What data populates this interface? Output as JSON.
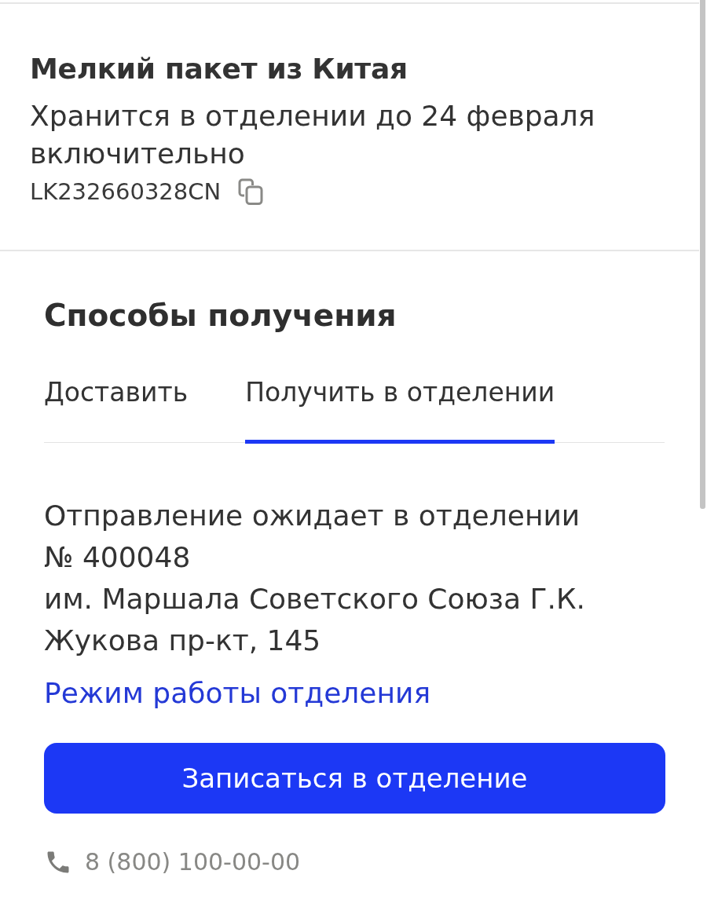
{
  "package": {
    "title": "Мелкий пакет из Китая",
    "storage_note": "Хранится в отделении до 24 февраля включительно",
    "tracking_number": "LK232660328CN"
  },
  "pickup": {
    "heading": "Способы получения",
    "tabs": [
      {
        "label": "Доставить",
        "selected": false
      },
      {
        "label": "Получить в отделении",
        "selected": true
      }
    ],
    "office": {
      "status": "Отправление ожидает в отделении № 400048",
      "address": "им. Маршала Советского Союза Г.К. Жукова пр-кт, 145",
      "hours_link": "Режим работы отделения"
    },
    "book_button": "Записаться в отделение",
    "phone": "8 (800) 100-00-00"
  }
}
